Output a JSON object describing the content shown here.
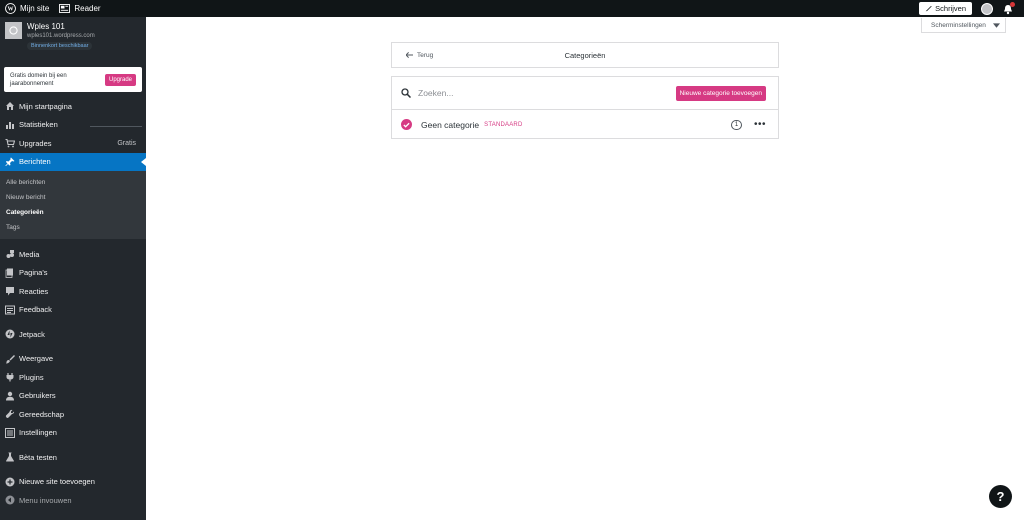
{
  "topbar": {
    "my_site": "Mijn site",
    "reader": "Reader",
    "write": "Schrijven"
  },
  "site": {
    "name": "Wples 101",
    "url": "wples101.wordpress.com",
    "badge": "Binnenkort beschikbaar"
  },
  "upsell": {
    "text": "Gratis domein bij een jaarabonnement",
    "button": "Upgrade"
  },
  "menu": {
    "home": "Mijn startpagina",
    "stats": "Statistieken",
    "upgrades": "Upgrades",
    "upgrades_extra": "Gratis",
    "posts": "Berichten",
    "sub": {
      "all": "Alle berichten",
      "new": "Nieuw bericht",
      "categories": "Categorieën",
      "tags": "Tags"
    },
    "media": "Media",
    "pages": "Pagina's",
    "comments": "Reacties",
    "feedback": "Feedback",
    "jetpack": "Jetpack",
    "appearance": "Weergave",
    "plugins": "Plugins",
    "users": "Gebruikers",
    "tools": "Gereedschap",
    "settings": "Instellingen",
    "beta": "Bèta testen",
    "add_site": "Nieuwe site toevoegen",
    "collapse": "Menu invouwen"
  },
  "screen_options": "Scherminstellingen",
  "header": {
    "back": "Terug",
    "title": "Categorieën"
  },
  "search": {
    "placeholder": "Zoeken..."
  },
  "new_category_button": "Nieuwe categorie toevoegen",
  "categories": [
    {
      "name": "Geen categorie",
      "tag": "STANDAARD",
      "count": "1"
    }
  ],
  "help": "?",
  "colors": {
    "accent": "#d63a83",
    "active_menu": "#0675c4",
    "sidebar": "#23282d",
    "topbar": "#101517"
  }
}
